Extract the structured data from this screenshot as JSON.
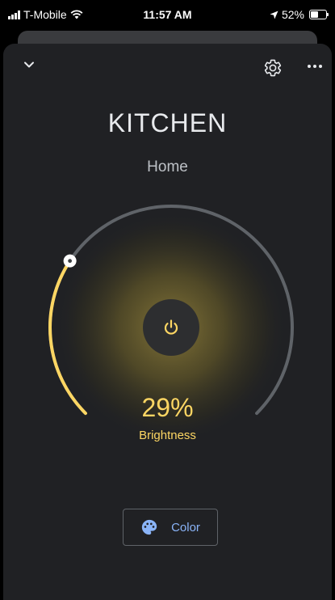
{
  "status_bar": {
    "carrier": "T-Mobile",
    "time": "11:57 AM",
    "battery": "52%",
    "battery_level": 0.52
  },
  "header": {
    "collapse_icon": "chevron-down-icon",
    "settings_icon": "gear-icon",
    "more_icon": "more-horiz-icon"
  },
  "device": {
    "name": "KITCHEN",
    "room": "Home"
  },
  "brightness": {
    "value": 29,
    "display": "29%",
    "label": "Brightness",
    "fraction": 0.29
  },
  "power": {
    "icon": "power-icon"
  },
  "color_button": {
    "label": "Color",
    "icon": "palette-icon"
  },
  "colors": {
    "background": "#202124",
    "accent": "#fdd663",
    "track": "#5f6368",
    "link": "#8ab4f8"
  }
}
